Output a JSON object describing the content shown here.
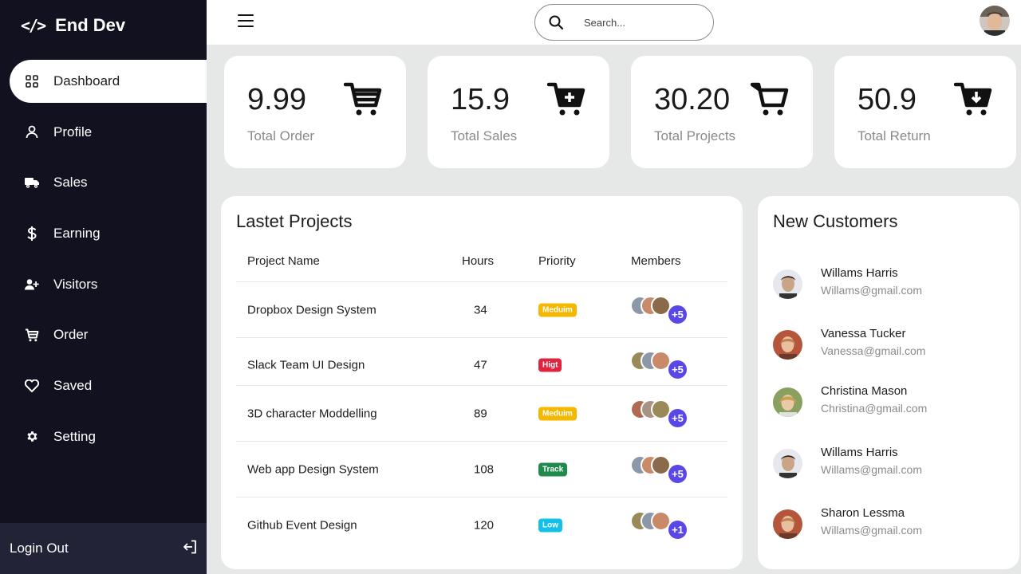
{
  "brand": {
    "code": "</>",
    "name": "End Dev"
  },
  "sidebar": {
    "items": [
      {
        "label": "Dashboard",
        "icon": "grid-icon"
      },
      {
        "label": "Profile",
        "icon": "user-icon"
      },
      {
        "label": "Sales",
        "icon": "truck-icon"
      },
      {
        "label": "Earning",
        "icon": "dollar-icon"
      },
      {
        "label": "Visitors",
        "icon": "user-plus-icon"
      },
      {
        "label": "Order",
        "icon": "cart-icon"
      },
      {
        "label": "Saved",
        "icon": "heart-icon"
      },
      {
        "label": "Setting",
        "icon": "gear-icon"
      }
    ],
    "logout_label": "Login Out"
  },
  "search": {
    "placeholder": "Search..."
  },
  "stats": [
    {
      "value": "9.99",
      "label": "Total Order"
    },
    {
      "value": "15.9",
      "label": "Total Sales"
    },
    {
      "value": "30.20",
      "label": "Total Projects"
    },
    {
      "value": "50.9",
      "label": "Total Return"
    }
  ],
  "projects": {
    "title": "Lastet Projects",
    "headers": [
      "Project Name",
      "Hours",
      "Priority",
      "Members"
    ],
    "rows": [
      {
        "name": "Dropbox Design System",
        "hours": "34",
        "priority": "Meduim",
        "members_extra": "+5"
      },
      {
        "name": "Slack Team UI Design",
        "hours": "47",
        "priority": "Higt",
        "members_extra": "+5"
      },
      {
        "name": "3D character Moddelling",
        "hours": "89",
        "priority": "Meduim",
        "members_extra": "+5"
      },
      {
        "name": "Web app Design System",
        "hours": "108",
        "priority": "Track",
        "members_extra": "+5"
      },
      {
        "name": "Github Event Design",
        "hours": "120",
        "priority": "Low",
        "members_extra": "+1"
      }
    ]
  },
  "customers": {
    "title": "New Customers",
    "list": [
      {
        "name": "Willams Harris",
        "email": "Willams@gmail.com"
      },
      {
        "name": "Vanessa Tucker",
        "email": "Vanessa@gmail.com"
      },
      {
        "name": "Christina Mason",
        "email": "Christina@gmail.com"
      },
      {
        "name": "Willams Harris",
        "email": "Willams@gmail.com"
      },
      {
        "name": "Sharon Lessma",
        "email": "Willams@gmail.com"
      }
    ]
  },
  "colors": {
    "sidebar_bg": "#11111f",
    "logout_bg": "#232337",
    "badge_medium": "#f5b800",
    "badge_high": "#e0243f",
    "badge_track": "#1f8a4c",
    "badge_low": "#13c0e8",
    "members_plus": "#5a47e8"
  }
}
